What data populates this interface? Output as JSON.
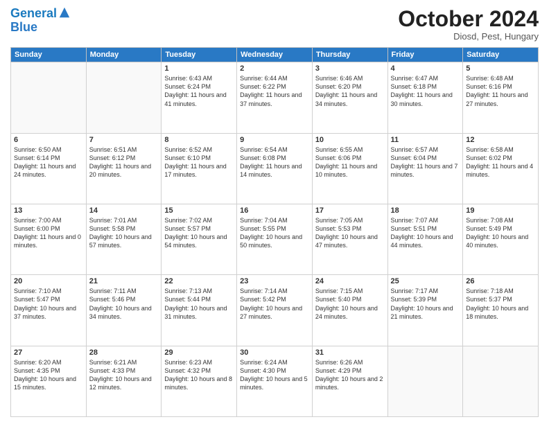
{
  "header": {
    "logo_line1": "General",
    "logo_line2": "Blue",
    "month_title": "October 2024",
    "location": "Diosd, Pest, Hungary"
  },
  "days_of_week": [
    "Sunday",
    "Monday",
    "Tuesday",
    "Wednesday",
    "Thursday",
    "Friday",
    "Saturday"
  ],
  "weeks": [
    [
      {
        "day": "",
        "text": ""
      },
      {
        "day": "",
        "text": ""
      },
      {
        "day": "1",
        "text": "Sunrise: 6:43 AM\nSunset: 6:24 PM\nDaylight: 11 hours and 41 minutes."
      },
      {
        "day": "2",
        "text": "Sunrise: 6:44 AM\nSunset: 6:22 PM\nDaylight: 11 hours and 37 minutes."
      },
      {
        "day": "3",
        "text": "Sunrise: 6:46 AM\nSunset: 6:20 PM\nDaylight: 11 hours and 34 minutes."
      },
      {
        "day": "4",
        "text": "Sunrise: 6:47 AM\nSunset: 6:18 PM\nDaylight: 11 hours and 30 minutes."
      },
      {
        "day": "5",
        "text": "Sunrise: 6:48 AM\nSunset: 6:16 PM\nDaylight: 11 hours and 27 minutes."
      }
    ],
    [
      {
        "day": "6",
        "text": "Sunrise: 6:50 AM\nSunset: 6:14 PM\nDaylight: 11 hours and 24 minutes."
      },
      {
        "day": "7",
        "text": "Sunrise: 6:51 AM\nSunset: 6:12 PM\nDaylight: 11 hours and 20 minutes."
      },
      {
        "day": "8",
        "text": "Sunrise: 6:52 AM\nSunset: 6:10 PM\nDaylight: 11 hours and 17 minutes."
      },
      {
        "day": "9",
        "text": "Sunrise: 6:54 AM\nSunset: 6:08 PM\nDaylight: 11 hours and 14 minutes."
      },
      {
        "day": "10",
        "text": "Sunrise: 6:55 AM\nSunset: 6:06 PM\nDaylight: 11 hours and 10 minutes."
      },
      {
        "day": "11",
        "text": "Sunrise: 6:57 AM\nSunset: 6:04 PM\nDaylight: 11 hours and 7 minutes."
      },
      {
        "day": "12",
        "text": "Sunrise: 6:58 AM\nSunset: 6:02 PM\nDaylight: 11 hours and 4 minutes."
      }
    ],
    [
      {
        "day": "13",
        "text": "Sunrise: 7:00 AM\nSunset: 6:00 PM\nDaylight: 11 hours and 0 minutes."
      },
      {
        "day": "14",
        "text": "Sunrise: 7:01 AM\nSunset: 5:58 PM\nDaylight: 10 hours and 57 minutes."
      },
      {
        "day": "15",
        "text": "Sunrise: 7:02 AM\nSunset: 5:57 PM\nDaylight: 10 hours and 54 minutes."
      },
      {
        "day": "16",
        "text": "Sunrise: 7:04 AM\nSunset: 5:55 PM\nDaylight: 10 hours and 50 minutes."
      },
      {
        "day": "17",
        "text": "Sunrise: 7:05 AM\nSunset: 5:53 PM\nDaylight: 10 hours and 47 minutes."
      },
      {
        "day": "18",
        "text": "Sunrise: 7:07 AM\nSunset: 5:51 PM\nDaylight: 10 hours and 44 minutes."
      },
      {
        "day": "19",
        "text": "Sunrise: 7:08 AM\nSunset: 5:49 PM\nDaylight: 10 hours and 40 minutes."
      }
    ],
    [
      {
        "day": "20",
        "text": "Sunrise: 7:10 AM\nSunset: 5:47 PM\nDaylight: 10 hours and 37 minutes."
      },
      {
        "day": "21",
        "text": "Sunrise: 7:11 AM\nSunset: 5:46 PM\nDaylight: 10 hours and 34 minutes."
      },
      {
        "day": "22",
        "text": "Sunrise: 7:13 AM\nSunset: 5:44 PM\nDaylight: 10 hours and 31 minutes."
      },
      {
        "day": "23",
        "text": "Sunrise: 7:14 AM\nSunset: 5:42 PM\nDaylight: 10 hours and 27 minutes."
      },
      {
        "day": "24",
        "text": "Sunrise: 7:15 AM\nSunset: 5:40 PM\nDaylight: 10 hours and 24 minutes."
      },
      {
        "day": "25",
        "text": "Sunrise: 7:17 AM\nSunset: 5:39 PM\nDaylight: 10 hours and 21 minutes."
      },
      {
        "day": "26",
        "text": "Sunrise: 7:18 AM\nSunset: 5:37 PM\nDaylight: 10 hours and 18 minutes."
      }
    ],
    [
      {
        "day": "27",
        "text": "Sunrise: 6:20 AM\nSunset: 4:35 PM\nDaylight: 10 hours and 15 minutes."
      },
      {
        "day": "28",
        "text": "Sunrise: 6:21 AM\nSunset: 4:33 PM\nDaylight: 10 hours and 12 minutes."
      },
      {
        "day": "29",
        "text": "Sunrise: 6:23 AM\nSunset: 4:32 PM\nDaylight: 10 hours and 8 minutes."
      },
      {
        "day": "30",
        "text": "Sunrise: 6:24 AM\nSunset: 4:30 PM\nDaylight: 10 hours and 5 minutes."
      },
      {
        "day": "31",
        "text": "Sunrise: 6:26 AM\nSunset: 4:29 PM\nDaylight: 10 hours and 2 minutes."
      },
      {
        "day": "",
        "text": ""
      },
      {
        "day": "",
        "text": ""
      }
    ]
  ]
}
